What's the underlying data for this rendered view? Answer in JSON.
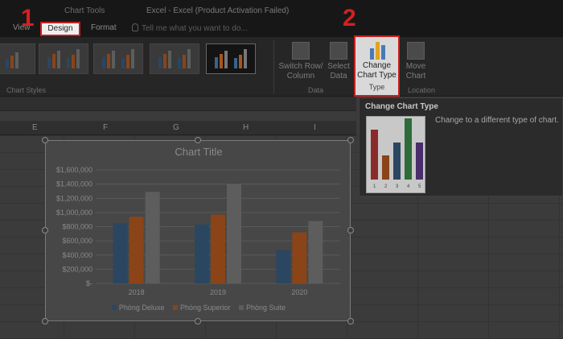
{
  "titlebar": {
    "context_label": "Chart Tools",
    "window_title": "Excel - Excel (Product Activation Failed)"
  },
  "tabs": [
    {
      "label": "View"
    },
    {
      "label": "Design"
    },
    {
      "label": "Format"
    }
  ],
  "tell_me": {
    "placeholder": "Tell me what you want to do..."
  },
  "ribbon": {
    "chart_styles_label": "Chart Styles",
    "switch_row_column": "Switch Row/ Column",
    "select_data": "Select Data",
    "data_group_label": "Data",
    "change_chart_type": "Change Chart Type",
    "type_group_label": "Type",
    "move_chart": "Move Chart",
    "location_group_label": "Location"
  },
  "columns": [
    "E",
    "F",
    "G",
    "H",
    "I"
  ],
  "colors": {
    "deluxe": "#2b4661",
    "superior": "#8a4418",
    "suite": "#5d5d5d",
    "annotation_red": "#c81e1e"
  },
  "tooltip": {
    "title": "Change Chart Type",
    "description": "Change to a different type of chart."
  },
  "annotations": {
    "step1": "1",
    "step2": "2"
  },
  "chart_data": {
    "type": "bar",
    "title": "Chart Title",
    "categories": [
      "2018",
      "2019",
      "2020"
    ],
    "series": [
      {
        "name": "Phòng Deluxe",
        "values": [
          850000,
          830000,
          470000
        ]
      },
      {
        "name": "Phòng Superior",
        "values": [
          940000,
          970000,
          720000
        ]
      },
      {
        "name": "Phòng Suite",
        "values": [
          1290000,
          1400000,
          880000
        ]
      }
    ],
    "ylim": [
      0,
      1600000
    ],
    "yticks": [
      "$1,600,000",
      "$1,400,000",
      "$1,200,000",
      "$1,000,000",
      "$800,000",
      "$600,000",
      "$400,000",
      "$200,000",
      "$-"
    ],
    "grid": true,
    "legend": "bottom"
  }
}
